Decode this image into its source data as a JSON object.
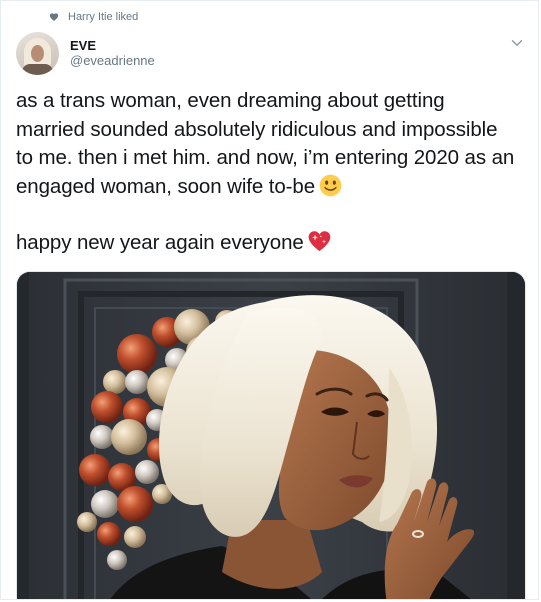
{
  "social_context": {
    "icon": "heart-icon",
    "text": "Harry Itie liked"
  },
  "author": {
    "display_name": "EVE",
    "handle": "@eveadrienne"
  },
  "tweet": {
    "paragraph_1": "as a trans woman, even dreaming about getting married sounded absolutely ridiculous and impossible to me. then i met him. and now, i’m entering 2020 as an engaged woman, soon wife to-be",
    "paragraph_1_emoji": "slightly-smiling-face-emoji",
    "paragraph_2": "happy new year again everyone",
    "paragraph_2_emoji": "sparkling-heart-emoji"
  },
  "media": {
    "type": "photo"
  },
  "colors": {
    "text_primary": "#14171a",
    "text_secondary": "#657786",
    "border": "#e6ecf0"
  }
}
